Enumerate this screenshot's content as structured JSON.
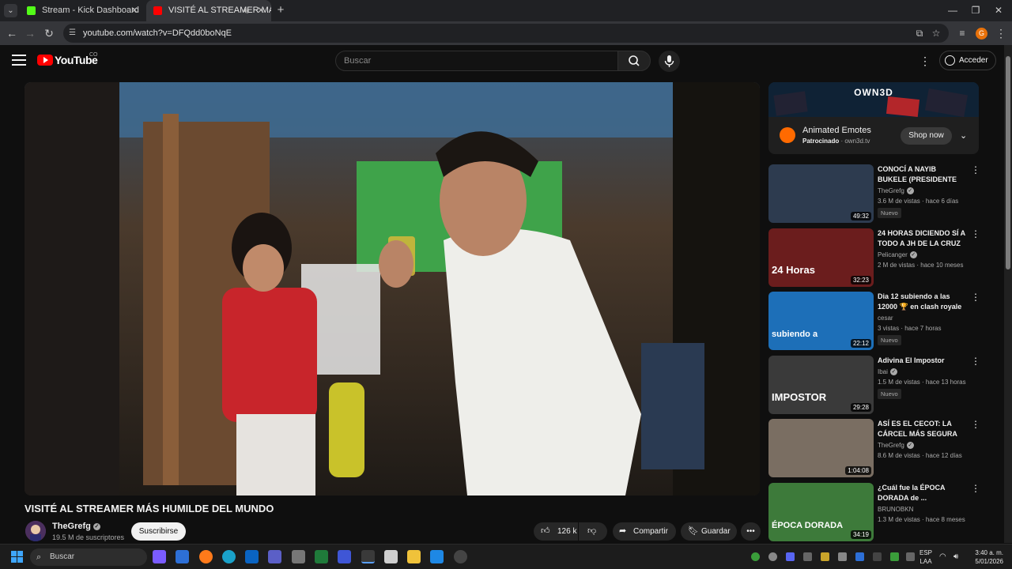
{
  "browser": {
    "tabs": [
      {
        "title": "Stream - Kick Dashboard",
        "active": false
      },
      {
        "title": "VISITÉ AL STREAMER MÁS H",
        "active": true
      }
    ],
    "url": "youtube.com/watch?v=DFQdd0boNqE",
    "profile_initial": "G"
  },
  "masthead": {
    "logo_text": "YouTube",
    "country_code": "CO",
    "search_placeholder": "Buscar",
    "sign_in_label": "Acceder"
  },
  "video": {
    "title": "VISITÉ AL STREAMER MÁS HUMILDE DEL MUNDO",
    "channel_name": "TheGrefg",
    "subscribers": "19.5 M de suscriptores",
    "subscribe_label": "Suscribirse",
    "likes": "126 k",
    "share_label": "Compartir",
    "save_label": "Guardar"
  },
  "ad": {
    "brand_banner": "OWN3D",
    "title": "Animated Emotes",
    "sponsored_label": "Patrocinado",
    "domain": "own3d.tv",
    "cta_label": "Shop now"
  },
  "recommendations": [
    {
      "title": "CONOCÍ A NAYIB BUKELE (PRESIDENTE DE EL ...",
      "channel": "TheGrefg",
      "verified": true,
      "views": "3.6 M de vistas",
      "age": "hace 6 días",
      "duration": "49:32",
      "badge": "Nuevo",
      "thumb_color": "#2d3b4f"
    },
    {
      "title": "24 HORAS DICIENDO SÍ A TODO A JH DE LA CRUZ ...",
      "channel": "Pelicanger",
      "verified": true,
      "views": "2 M de vistas",
      "age": "hace 10 meses",
      "duration": "32:23",
      "badge": "",
      "thumb_color": "#6b1d1d",
      "thumb_text": "24 Horas"
    },
    {
      "title": "Dia 12 subiendo a las 12000 🏆 en clash royale",
      "channel": "cesar",
      "verified": false,
      "views": "3 vistas",
      "age": "hace 7 horas",
      "duration": "22:12",
      "badge": "Nuevo",
      "thumb_color": "#1d6fb8",
      "thumb_text": "subiendo a"
    },
    {
      "title": "Adivina El Impostor",
      "channel": "Ibai",
      "verified": true,
      "views": "1.5 M de vistas",
      "age": "hace 13 horas",
      "duration": "29:28",
      "badge": "Nuevo",
      "thumb_color": "#3a3a3a",
      "thumb_text": "IMPOSTOR"
    },
    {
      "title": "ASÍ ES EL CECOT: LA CÁRCEL MÁS SEGURA D...",
      "channel": "TheGrefg",
      "verified": true,
      "views": "8.6 M de vistas",
      "age": "hace 12 días",
      "duration": "1:04:08",
      "badge": "",
      "thumb_color": "#7a6e62"
    },
    {
      "title": "¿Cuál fue la ÉPOCA DORADA de ...",
      "channel": "BRUNOBKN",
      "verified": false,
      "views": "1.3 M de vistas",
      "age": "hace 8 meses",
      "duration": "34:19",
      "badge": "",
      "thumb_color": "#3d7a3a",
      "thumb_text": "ÉPOCA DORADA"
    }
  ],
  "taskbar": {
    "search_label": "Buscar",
    "language": "ESP",
    "language_sub": "LAA",
    "time": "3:40 a. m.",
    "date": "5/01/2026"
  }
}
